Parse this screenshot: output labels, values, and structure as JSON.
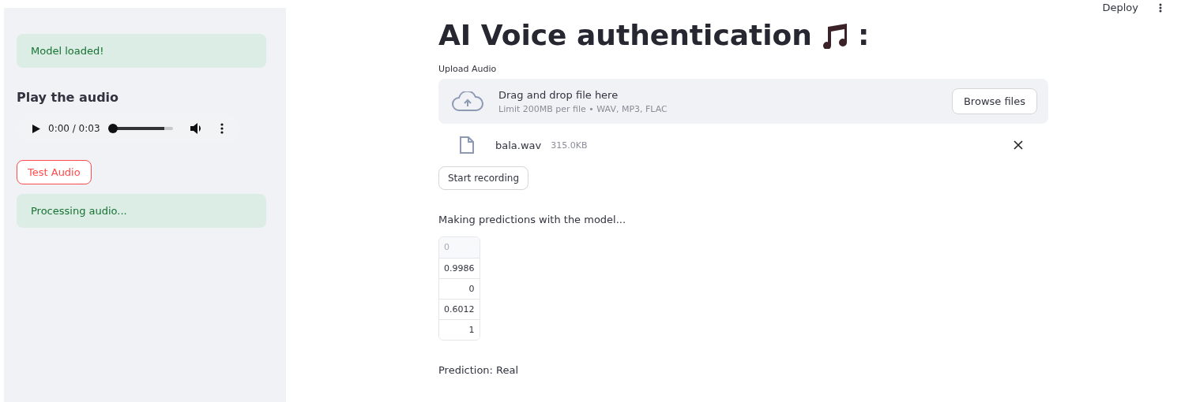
{
  "header": {
    "deploy": "Deploy"
  },
  "sidebar": {
    "alerts": [
      {
        "text": "Model loaded!"
      }
    ],
    "heading": "Play the audio",
    "audio": {
      "time": "0:00 / 0:03",
      "level": 0
    },
    "test_button": "Test Audio",
    "status": {
      "text": "Processing audio..."
    }
  },
  "main": {
    "title": "AI Voice authentication",
    "title_suffix": ":",
    "uploader": {
      "label": "Upload Audio",
      "prompt": "Drag and drop file here",
      "limit": "Limit 200MB per file • WAV, MP3, FLAC",
      "browse": "Browse files"
    },
    "file": {
      "name": "bala.wav",
      "size": "315.0KB"
    },
    "record_button": "Start recording",
    "progress_text": "Making predictions with the model...",
    "table": {
      "columns": [
        "0"
      ],
      "rows": [
        "0.9986",
        "0",
        "0.6012",
        "1"
      ]
    },
    "prediction": "Prediction: Real"
  }
}
